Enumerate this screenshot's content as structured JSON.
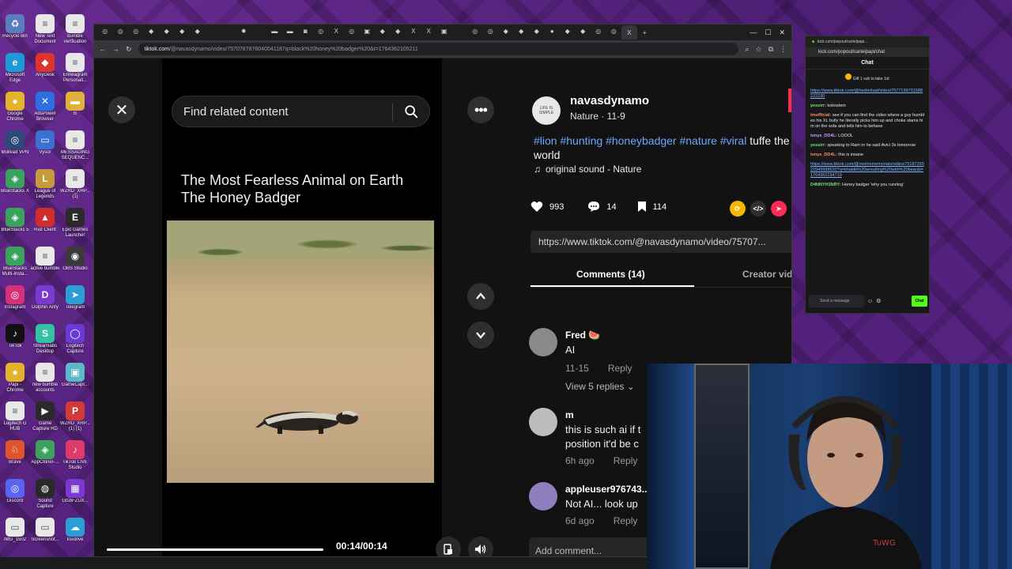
{
  "desktop": {
    "icons": [
      {
        "label": "Recycle Bin",
        "color": "#5a7dbf",
        "glyph": "♻"
      },
      {
        "label": "New Text Document",
        "color": "#e8e8e8",
        "glyph": "≡"
      },
      {
        "label": "bumble verification",
        "color": "#e8e8e8",
        "glyph": "≡"
      },
      {
        "label": "Microsoft Edge",
        "color": "#1c9bd8",
        "glyph": "e"
      },
      {
        "label": "AnyDesk",
        "color": "#e0332d",
        "glyph": "◆"
      },
      {
        "label": "Enneagram Personali...",
        "color": "#e8e8e8",
        "glyph": "≡"
      },
      {
        "label": "Google Chrome",
        "color": "#e2b32b",
        "glyph": "●"
      },
      {
        "label": "AdsPower Browser",
        "color": "#2c6fe0",
        "glyph": "✕"
      },
      {
        "label": "B",
        "color": "#e0b13a",
        "glyph": "▬"
      },
      {
        "label": "Mullvad VPN",
        "color": "#2b4a7a",
        "glyph": "◎"
      },
      {
        "label": "Vysor",
        "color": "#3b6fd1",
        "glyph": "▭"
      },
      {
        "label": "MESSAGING SEQUENC...",
        "color": "#e8e8e8",
        "glyph": "≡"
      },
      {
        "label": "BlueStacks X",
        "color": "#3aa35b",
        "glyph": "◈"
      },
      {
        "label": "League of Legends",
        "color": "#c79a3a",
        "glyph": "L"
      },
      {
        "label": "WZRD_XRP... (1)",
        "color": "#e8e8e8",
        "glyph": "≡"
      },
      {
        "label": "BlueStacks 5",
        "color": "#3aa35b",
        "glyph": "◈"
      },
      {
        "label": "Riot Client",
        "color": "#d22c2c",
        "glyph": "▲"
      },
      {
        "label": "Epic Games Launcher",
        "color": "#2a2a2a",
        "glyph": "E"
      },
      {
        "label": "BlueStacks Multi-Insta...",
        "color": "#3aa35b",
        "glyph": "◈"
      },
      {
        "label": "active bumble",
        "color": "#e8e8e8",
        "glyph": "≡"
      },
      {
        "label": "OBS Studio",
        "color": "#3a3a3a",
        "glyph": "◉"
      },
      {
        "label": "Instagram",
        "color": "#d6307a",
        "glyph": "◎"
      },
      {
        "label": "Dolphin Anty",
        "color": "#7a3ad0",
        "glyph": "D"
      },
      {
        "label": "Telegram",
        "color": "#2a9fd6",
        "glyph": "➤"
      },
      {
        "label": "TikTok",
        "color": "#111111",
        "glyph": "♪"
      },
      {
        "label": "Streamlabs Desktop",
        "color": "#31c3a2",
        "glyph": "S"
      },
      {
        "label": "Logitech Capture",
        "color": "#6a3ad6",
        "glyph": "◯"
      },
      {
        "label": "Papi - Chrome",
        "color": "#e2b32b",
        "glyph": "●"
      },
      {
        "label": "new bumble accounts",
        "color": "#e8e8e8",
        "glyph": "≡"
      },
      {
        "label": "GameCapt...",
        "color": "#5bb8c6",
        "glyph": "▣"
      },
      {
        "label": "Logitech G HUB",
        "color": "#e8e8e8",
        "glyph": "≡"
      },
      {
        "label": "Game Capture HD",
        "color": "#2a2a2a",
        "glyph": "▶"
      },
      {
        "label": "WZRD_XRP... (1) (1)",
        "color": "#d23a3a",
        "glyph": "P"
      },
      {
        "label": "Brave",
        "color": "#e0542d",
        "glyph": "♘"
      },
      {
        "label": "AppCloner-...",
        "color": "#3aa35b",
        "glyph": "◈"
      },
      {
        "label": "TikTok LIVE Studio",
        "color": "#e03a6a",
        "glyph": "♪"
      },
      {
        "label": "Discord",
        "color": "#5865f2",
        "glyph": "◎"
      },
      {
        "label": "Sound Capture",
        "color": "#2a2a2a",
        "glyph": "◍"
      },
      {
        "label": "GtsbFZUX...",
        "color": "#7a3ad0",
        "glyph": "▦"
      },
      {
        "label": "IMG_1502",
        "color": "#e8e8e8",
        "glyph": "▭"
      },
      {
        "label": "Screenshot...",
        "color": "#e8e8e8",
        "glyph": "▭"
      },
      {
        "label": "Icedrive",
        "color": "#2a9fd6",
        "glyph": "☁"
      }
    ]
  },
  "browser": {
    "tabs": [
      "◎",
      "◎",
      "◎",
      "◆",
      "◆",
      "◆",
      "◆",
      "",
      "",
      "✸",
      "",
      "▬",
      "▬",
      "◙",
      "◎",
      "X",
      "◎",
      "▣",
      "◆",
      "◆",
      "X",
      "X",
      "▣",
      "",
      "◎",
      "◎",
      "◆",
      "◆",
      "◆",
      "●",
      "◆",
      "◆",
      "◎",
      "◎",
      "X"
    ],
    "new_tab": "+",
    "window_controls": {
      "minimize": "—",
      "maximize": "☐",
      "close": "✕"
    },
    "url_host": "tiktok.com",
    "url_path": "/@navasdynamo/video/7570787876040041187q=black%20honey%20badger%20&t=1764362105211"
  },
  "video": {
    "search_placeholder": "Find related content",
    "title_line1": "The Most Fearless Animal on Earth",
    "title_line2": "The Honey Badger",
    "time": "00:14/00:14",
    "progress": 1.0
  },
  "details": {
    "avatar_text": "LIFE IS SIMPLE",
    "username": "navasdynamo",
    "subline": "Nature · 11-9",
    "hashtags": "#lion #hunting #honeybadger #nature #viral",
    "caption_rest": " tuffe the world",
    "sound": "original sound - Nature",
    "likes": "993",
    "comments_count": "14",
    "saves": "114",
    "link": "https://www.tiktok.com/@navasdynamo/video/75707...",
    "tab_comments": "Comments (14)",
    "tab_creator": "Creator vid",
    "view_replies": "View 5 replies",
    "add_comment": "Add comment...",
    "comments": [
      {
        "name": "Fred 🍉",
        "text": "AI",
        "date": "11-15",
        "reply": "Reply"
      },
      {
        "name": "m",
        "text": "this is such ai if t position it'd be c",
        "date": "6h ago",
        "reply": "Reply"
      },
      {
        "name": "appleuser976743...",
        "text": "Not AI... look up",
        "date": "6d ago",
        "reply": "Reply"
      }
    ]
  },
  "chat": {
    "window_title": "kick.com/popout/cartelpapi...",
    "url": "kick.com/popout/cartelpapi/chat",
    "header": "Chat",
    "gift": "Gift 1 sub to take 1st",
    "messages": [
      {
        "user": "",
        "text": "https://www.tiktok.com/@hedreload/video/7577199731588222230",
        "link": true
      },
      {
        "user": "yessirr:",
        "text": " kokostein"
      },
      {
        "user": "tmofficial:",
        "text": " see if you can find the video where a guy humbles his XL bully he literally picks him up and choke slams him on the sofa and tells him to behave"
      },
      {
        "user": "txnys_DD4L:",
        "text": " LOOOL"
      },
      {
        "user": "yessirr:",
        "text": " speaking to Ram rn he said Avici 3x tomorrow"
      },
      {
        "user": "txnys_DD4L:",
        "text": " this is insane"
      },
      {
        "user": "",
        "text": "https://www.tiktok.com/@mistriomemorials/video/7518726922549988630?q=khabib%20wrestling%20with%20bear&t=1764362154719",
        "link": true
      },
      {
        "user": "D4NNYH3NRY:",
        "text": " Honey badger 'why you running'"
      }
    ],
    "input_placeholder": "Send a message",
    "send_label": "Chat"
  },
  "colors": {
    "accent": "#fe2c55",
    "link": "#6aa8ff",
    "kick_green": "#53fc18"
  }
}
